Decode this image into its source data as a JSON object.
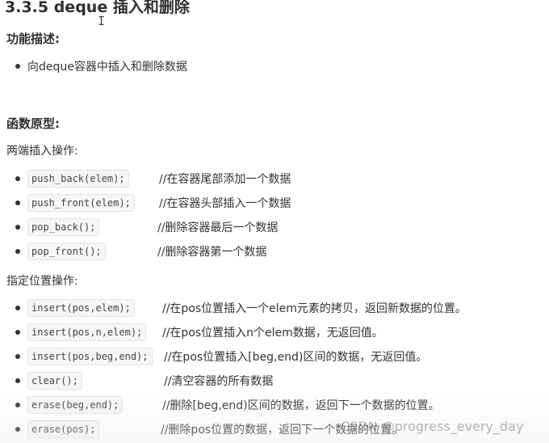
{
  "title": "3.3.5 deque 插入和删除",
  "cursor_glyph": "I",
  "feature_heading": "功能描述:",
  "feature_items": [
    "向deque容器中插入和删除数据"
  ],
  "prototype_heading": "函数原型:",
  "section1": {
    "label": "两端插入操作:",
    "items": [
      {
        "code": "push_back(elem);",
        "comment": "//在容器尾部添加一个数据"
      },
      {
        "code": "push_front(elem);",
        "comment": "//在容器头部插入一个数据"
      },
      {
        "code": "pop_back();",
        "comment": "//删除容器最后一个数据"
      },
      {
        "code": "pop_front();",
        "comment": "//删除容器第一个数据"
      }
    ]
  },
  "section2": {
    "label": "指定位置操作:",
    "items": [
      {
        "code": "insert(pos,elem);",
        "comment": "//在pos位置插入一个elem元素的拷贝，返回新数据的位置。"
      },
      {
        "code": "insert(pos,n,elem);",
        "comment": "//在pos位置插入n个elem数据，无返回值。"
      },
      {
        "code": "insert(pos,beg,end);",
        "comment": "//在pos位置插入[beg,end)区间的数据，无返回值。"
      },
      {
        "code": "clear();",
        "comment": "//清空容器的所有数据"
      },
      {
        "code": "erase(beg,end);",
        "comment": "//删除[beg,end)区间的数据，返回下一个数据的位置。"
      },
      {
        "code": "erase(pos);",
        "comment": "//删除pos位置的数据，返回下一个数据的位置。"
      }
    ]
  },
  "watermark": "CSDN @progress_every_day"
}
